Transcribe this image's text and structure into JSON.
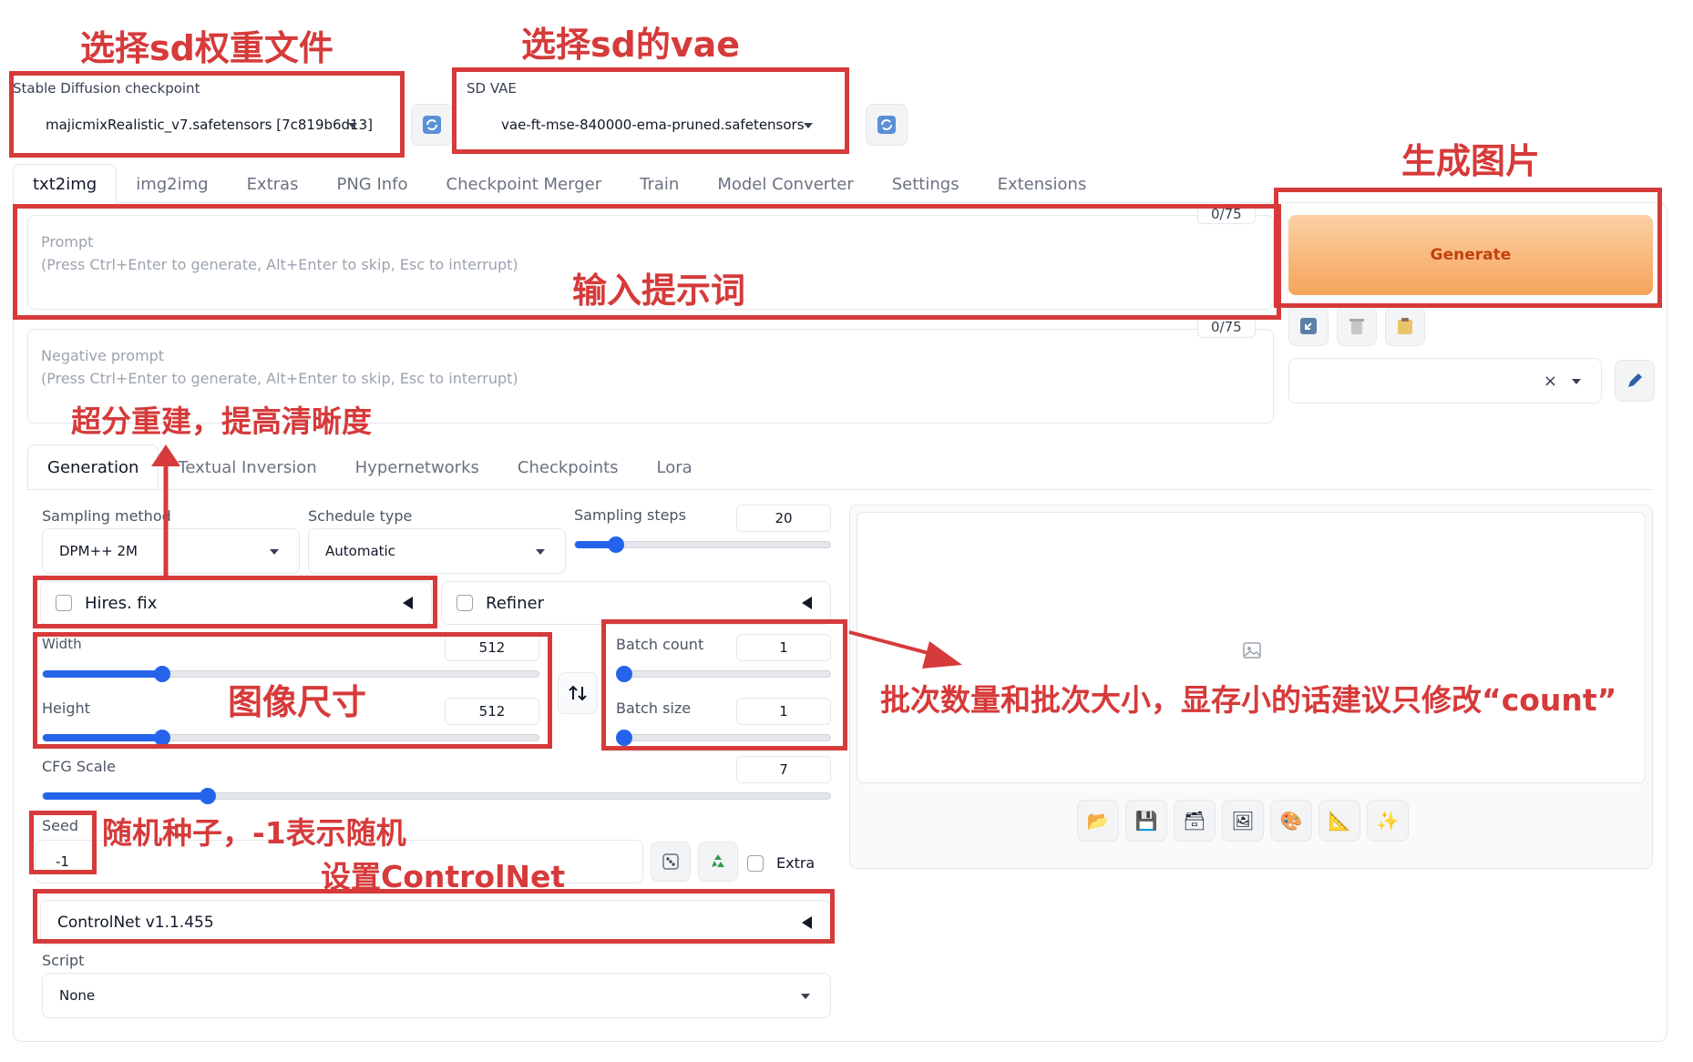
{
  "checkpoint": {
    "label": "Stable Diffusion checkpoint",
    "value": "majicmixRealistic_v7.safetensors [7c819b6d13]"
  },
  "vae": {
    "label": "SD VAE",
    "value": "vae-ft-mse-840000-ema-pruned.safetensors"
  },
  "main_tabs": [
    "txt2img",
    "img2img",
    "Extras",
    "PNG Info",
    "Checkpoint Merger",
    "Train",
    "Model Converter",
    "Settings",
    "Extensions"
  ],
  "prompt": {
    "label": "Prompt",
    "hint": "(Press Ctrl+Enter to generate, Alt+Enter to skip, Esc to interrupt)",
    "counter": "0/75"
  },
  "negative_prompt": {
    "label": "Negative prompt",
    "hint": "(Press Ctrl+Enter to generate, Alt+Enter to skip, Esc to interrupt)",
    "counter": "0/75"
  },
  "generate_label": "Generate",
  "style_clear": "×",
  "sub_tabs": [
    "Generation",
    "Textual Inversion",
    "Hypernetworks",
    "Checkpoints",
    "Lora"
  ],
  "sampling_method": {
    "label": "Sampling method",
    "value": "DPM++ 2M"
  },
  "schedule_type": {
    "label": "Schedule type",
    "value": "Automatic"
  },
  "sampling_steps": {
    "label": "Sampling steps",
    "value": "20",
    "fraction": 0.16
  },
  "hires_fix": {
    "label": "Hires. fix"
  },
  "refiner": {
    "label": "Refiner"
  },
  "width": {
    "label": "Width",
    "value": "512",
    "fraction": 0.24
  },
  "height": {
    "label": "Height",
    "value": "512",
    "fraction": 0.24
  },
  "batch_count": {
    "label": "Batch count",
    "value": "1",
    "fraction": 0.0
  },
  "batch_size": {
    "label": "Batch size",
    "value": "1",
    "fraction": 0.0
  },
  "cfg_scale": {
    "label": "CFG Scale",
    "value": "7",
    "fraction": 0.21
  },
  "seed": {
    "label": "Seed",
    "value": "-1"
  },
  "extra_label": "Extra",
  "controlnet_label": "ControlNet v1.1.455",
  "script": {
    "label": "Script",
    "value": "None"
  },
  "annotations": {
    "checkpoint": "选择sd权重文件",
    "vae": "选择sd的vae",
    "generate": "生成图片",
    "prompt": "输入提示词",
    "hires": "超分重建，提高清晰度",
    "size": "图像尺寸",
    "batch": "批次数量和批次大小，显存小的话建议只修改“count”",
    "seed": "随机种子，-1表示随机",
    "controlnet": "设置ControlNet"
  },
  "colors": {
    "annotation": "#d63a3a",
    "accent": "#2563eb",
    "generate": "#f6a55a"
  }
}
